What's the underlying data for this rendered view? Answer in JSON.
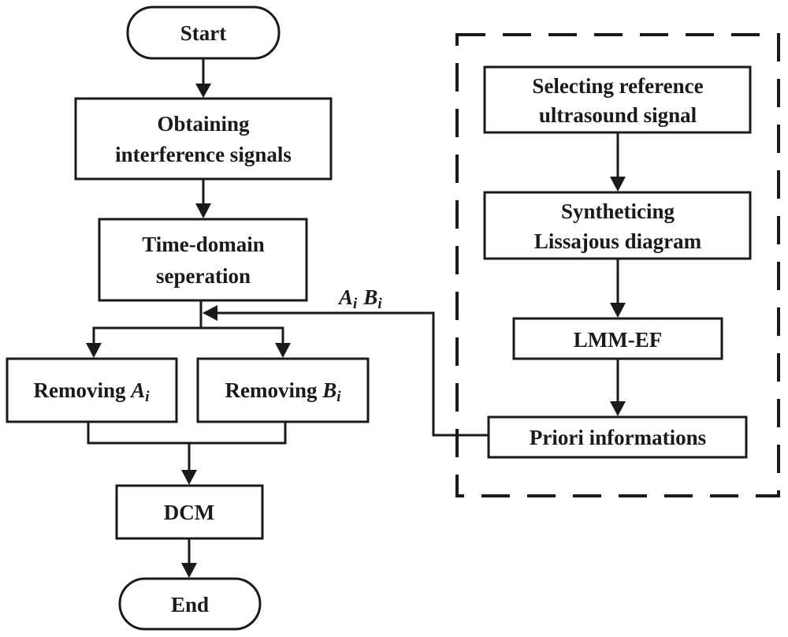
{
  "diagram": {
    "type": "flowchart",
    "main_flow": {
      "start": "Start",
      "obtaining": [
        "Obtaining",
        "interference signals"
      ],
      "time_domain": [
        "Time-domain",
        "seperation"
      ],
      "removing_a": {
        "prefix": "Removing ",
        "var": "A",
        "sub": "i"
      },
      "removing_b": {
        "prefix": "Removing ",
        "var": "B",
        "sub": "i"
      },
      "dcm": "DCM",
      "end": "End"
    },
    "feedback_label": {
      "a_var": "A",
      "a_sub": "i",
      "b_var": "B",
      "b_sub": "i"
    },
    "side_process": {
      "selecting": [
        "Selecting reference",
        "ultrasound signal"
      ],
      "synthesizing": [
        "Syntheticing",
        "Lissajous diagram"
      ],
      "lmm": "LMM-EF",
      "priori": "Priori informations"
    },
    "edges": [
      [
        "start",
        "obtaining"
      ],
      [
        "obtaining",
        "time_domain"
      ],
      [
        "time_domain",
        "removing_a"
      ],
      [
        "time_domain",
        "removing_b"
      ],
      [
        "removing_a",
        "dcm"
      ],
      [
        "removing_b",
        "dcm"
      ],
      [
        "dcm",
        "end"
      ],
      [
        "selecting",
        "synthesizing"
      ],
      [
        "synthesizing",
        "lmm"
      ],
      [
        "lmm",
        "priori"
      ],
      [
        "priori",
        "time_domain_output"
      ]
    ]
  }
}
